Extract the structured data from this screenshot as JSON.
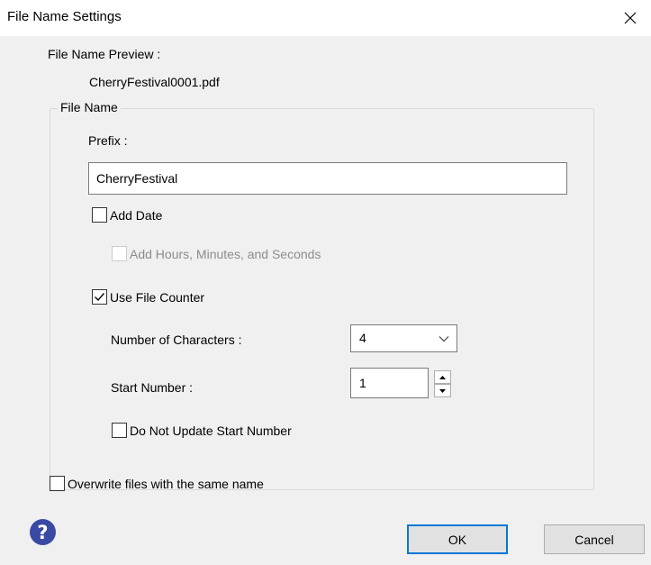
{
  "window": {
    "title": "File Name Settings",
    "close_glyph": "×"
  },
  "preview": {
    "label": "File Name Preview :",
    "value": "CherryFestival0001.pdf"
  },
  "file_name_group": {
    "legend": "File Name",
    "prefix_label": "Prefix :",
    "prefix_value": "CherryFestival",
    "add_date": {
      "label": "Add Date",
      "checked": false
    },
    "add_hms": {
      "label": "Add Hours, Minutes, and Seconds",
      "checked": false,
      "disabled": true
    },
    "use_counter": {
      "label": "Use File Counter",
      "checked": true
    },
    "num_chars_label": "Number of Characters :",
    "num_chars_value": "4",
    "start_number_label": "Start Number :",
    "start_number_value": "1",
    "do_not_update": {
      "label": "Do Not Update Start Number",
      "checked": false
    }
  },
  "overwrite": {
    "label": "Overwrite files with the same name",
    "checked": false
  },
  "footer": {
    "help_glyph": "?",
    "ok_label": "OK",
    "cancel_label": "Cancel"
  },
  "colors": {
    "dialog_bg": "#f0f0f0",
    "help_icon": "#3a4aa3",
    "default_button_border": "#0078d7"
  },
  "icons": [
    "close-icon",
    "help-icon",
    "chevron-down-icon",
    "spin-up-icon",
    "spin-down-icon",
    "checkmark-icon"
  ]
}
